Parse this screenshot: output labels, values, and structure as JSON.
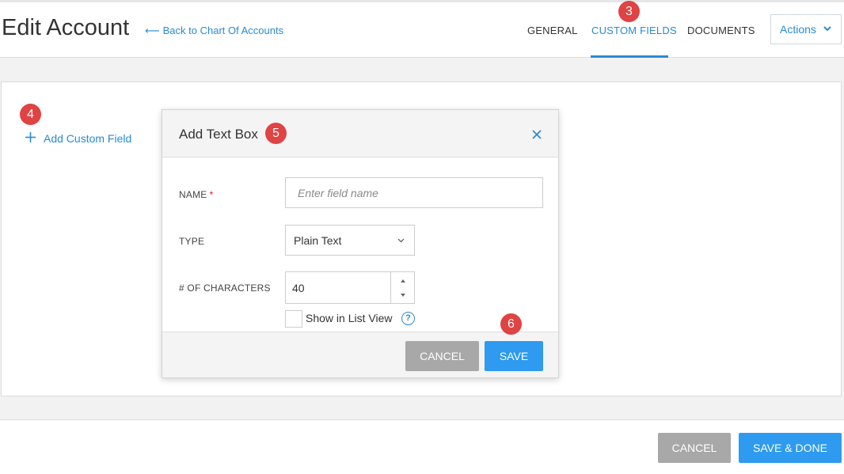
{
  "header": {
    "title": "Edit Account",
    "back_link": "Back to Chart Of Accounts",
    "tabs": [
      {
        "label": "GENERAL",
        "active": false
      },
      {
        "label": "CUSTOM FIELDS",
        "active": true
      },
      {
        "label": "DOCUMENTS",
        "active": false
      }
    ],
    "actions_label": "Actions"
  },
  "panel": {
    "add_custom_field": "Add Custom Field"
  },
  "modal": {
    "title": "Add Text Box",
    "name_label": "NAME",
    "name_required_mark": "*",
    "name_placeholder": "Enter field name",
    "type_label": "TYPE",
    "type_value": "Plain Text",
    "chars_label": "# OF CHARACTERS",
    "chars_value": "40",
    "show_in_list_label": "Show in List View",
    "help_glyph": "?",
    "cancel_label": "CANCEL",
    "save_label": "SAVE"
  },
  "footer": {
    "cancel_label": "CANCEL",
    "save_done_label": "SAVE & DONE"
  },
  "annotations": [
    "3",
    "4",
    "5",
    "6"
  ],
  "colors": {
    "accent": "#2a8ad4",
    "primary_button": "#2e9af0",
    "secondary_button": "#a8a8a8",
    "badge": "#e04343"
  }
}
